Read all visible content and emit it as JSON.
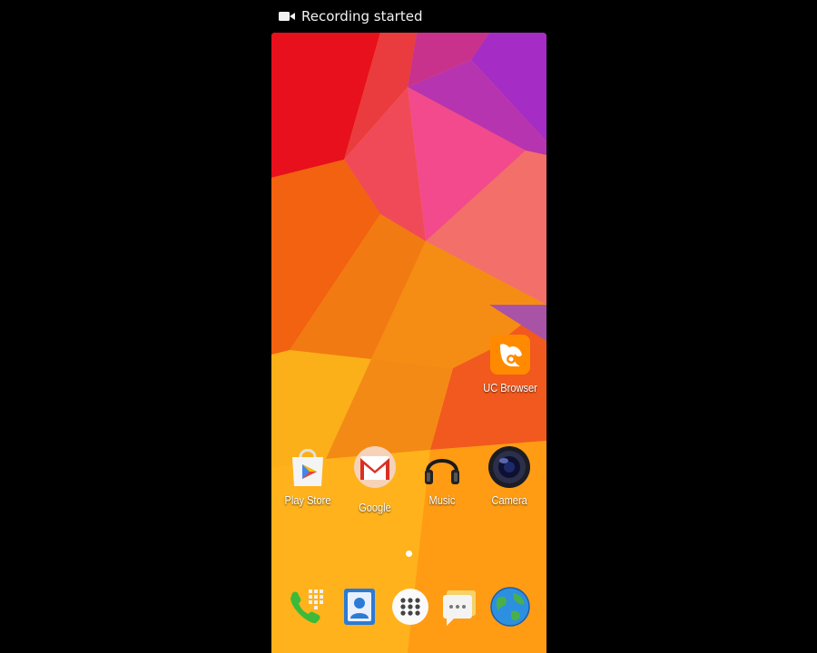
{
  "notification": {
    "icon": "video-camera-icon",
    "text": "Recording started"
  },
  "home": {
    "widget_app": {
      "label": "UC Browser",
      "icon": "uc-browser-icon"
    },
    "apps": [
      {
        "label": "Play Store",
        "icon": "play-store-icon"
      },
      {
        "label": "Google",
        "icon": "gmail-icon"
      },
      {
        "label": "Music",
        "icon": "headphones-icon"
      },
      {
        "label": "Camera",
        "icon": "camera-lens-icon"
      }
    ],
    "page_indicator": {
      "pages": 1,
      "current": 1
    }
  },
  "dock": [
    {
      "icon": "phone-dialer-icon"
    },
    {
      "icon": "contacts-icon"
    },
    {
      "icon": "app-drawer-icon"
    },
    {
      "icon": "messaging-icon"
    },
    {
      "icon": "browser-globe-icon"
    }
  ],
  "wallpaper": {
    "colors": [
      "#e8101c",
      "#f27a12",
      "#f24a8c",
      "#a52cc4",
      "#ffb71a"
    ]
  }
}
